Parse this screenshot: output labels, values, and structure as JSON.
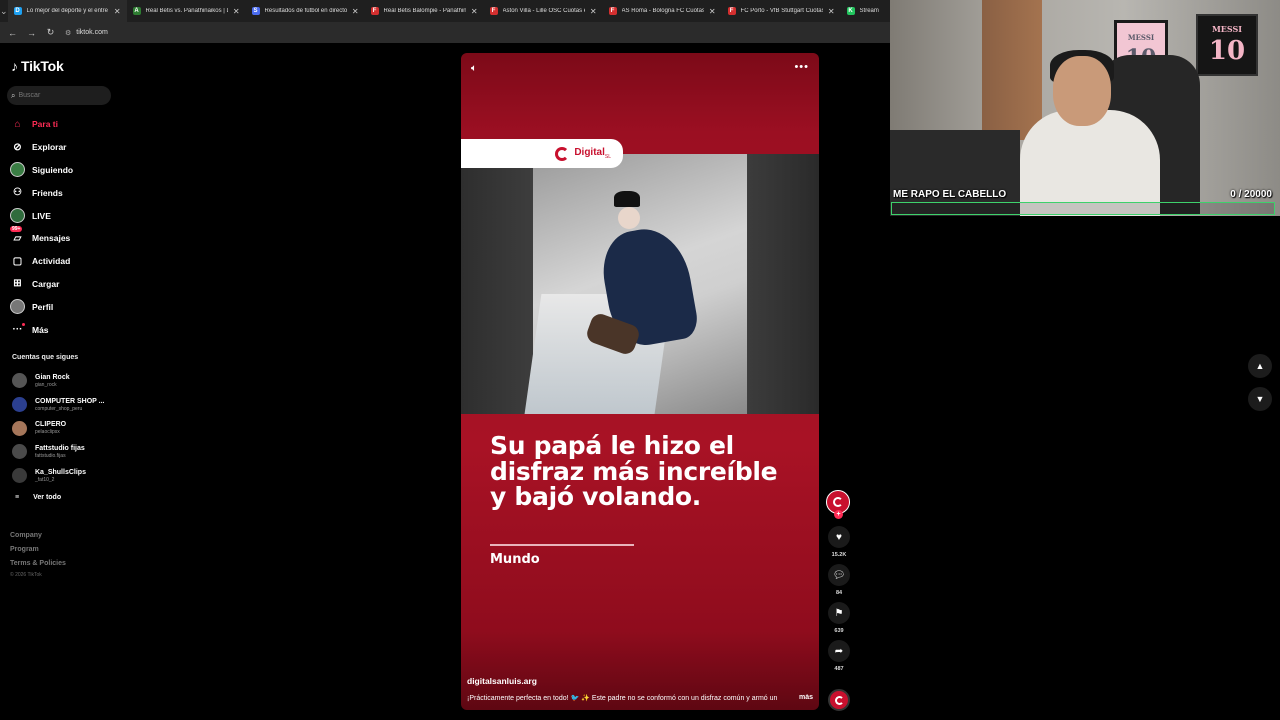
{
  "browser": {
    "tabs": [
      {
        "title": "Lo mejor del deporte y el entre",
        "color": "#1da1f2",
        "letter": "D"
      },
      {
        "title": "Real Betis vs. Panathinaikos | D",
        "color": "#2e7d32",
        "letter": "A"
      },
      {
        "title": "Resultados de fútbol en directo",
        "color": "#4b6cf0",
        "letter": "S"
      },
      {
        "title": "Real Betis Balompié - Panathin",
        "color": "#d32f2f",
        "letter": "F"
      },
      {
        "title": "Aston Villa - Lille OSC Cuotas e",
        "color": "#d32f2f",
        "letter": "F"
      },
      {
        "title": "AS Roma - Bologna FC Cuotas",
        "color": "#d32f2f",
        "letter": "F"
      },
      {
        "title": "FC Porto - VfB Stuttgart Cuotas",
        "color": "#d32f2f",
        "letter": "F"
      },
      {
        "title": "Stream",
        "color": "#22c55e",
        "letter": "K"
      }
    ],
    "url": "tiktok.com"
  },
  "sidebar": {
    "logo": "TikTok",
    "search_placeholder": "Buscar",
    "nav": [
      {
        "label": "Para ti",
        "icon": "home-icon",
        "glyph": "⌂"
      },
      {
        "label": "Explorar",
        "icon": "compass-icon",
        "glyph": "⊘"
      },
      {
        "label": "Siguiendo",
        "icon": "following-avatar-icon",
        "glyph": "●"
      },
      {
        "label": "Friends",
        "icon": "friends-icon",
        "glyph": "⚇"
      },
      {
        "label": "LIVE",
        "icon": "live-avatar-icon",
        "glyph": "●"
      },
      {
        "label": "Mensajes",
        "icon": "messages-icon",
        "glyph": "▱",
        "badge": "99+"
      },
      {
        "label": "Actividad",
        "icon": "activity-icon",
        "glyph": "▢"
      },
      {
        "label": "Cargar",
        "icon": "upload-icon",
        "glyph": "⊞"
      },
      {
        "label": "Perfil",
        "icon": "profile-avatar-icon",
        "glyph": "●"
      },
      {
        "label": "Más",
        "icon": "more-icon",
        "glyph": "···"
      }
    ],
    "following_heading": "Cuentas que sigues",
    "following": [
      {
        "name": "Gian Rock",
        "user": "gian_rock",
        "color": "#555"
      },
      {
        "name": "COMPUTER SHOP ...",
        "user": "computer_shop_peru",
        "color": "#2b3f8f"
      },
      {
        "name": "CLIPERO",
        "user": "pelaoclipsx",
        "color": "#a5765a"
      },
      {
        "name": "Fattstudio fijas",
        "user": "fattstudio.fijas",
        "color": "#4a4a4a"
      },
      {
        "name": "Ka_ShullsClips",
        "user": "_fat10_2",
        "color": "#3a3a3a"
      }
    ],
    "see_all": "Ver todo",
    "footer": [
      "Company",
      "Program",
      "Terms & Policies"
    ],
    "copyright": "© 2026 TikTok"
  },
  "video": {
    "brand": "Digital",
    "brand_suffix": "SL",
    "caption": "Su papá le hizo el disfraz más increíble y bajó volando.",
    "category": "Mundo",
    "author": "digitalsanluis.arg",
    "description": "¡Prácticamente perfecta en todo! 🐦 ✨ Este padre no se conformó con un disfraz común y armó un",
    "more": "más",
    "likes": "15.2K",
    "comments": "84",
    "saves": "639",
    "shares": "487"
  },
  "overlay": {
    "title": "ME RAPO EL CABELLO",
    "counter": "0  / 20000",
    "progress": 0,
    "frame1_text": "MESSI",
    "frame1_number": "10",
    "frame2_text": "MESSI",
    "frame2_number": "10",
    "accent": "#3ed16b"
  }
}
